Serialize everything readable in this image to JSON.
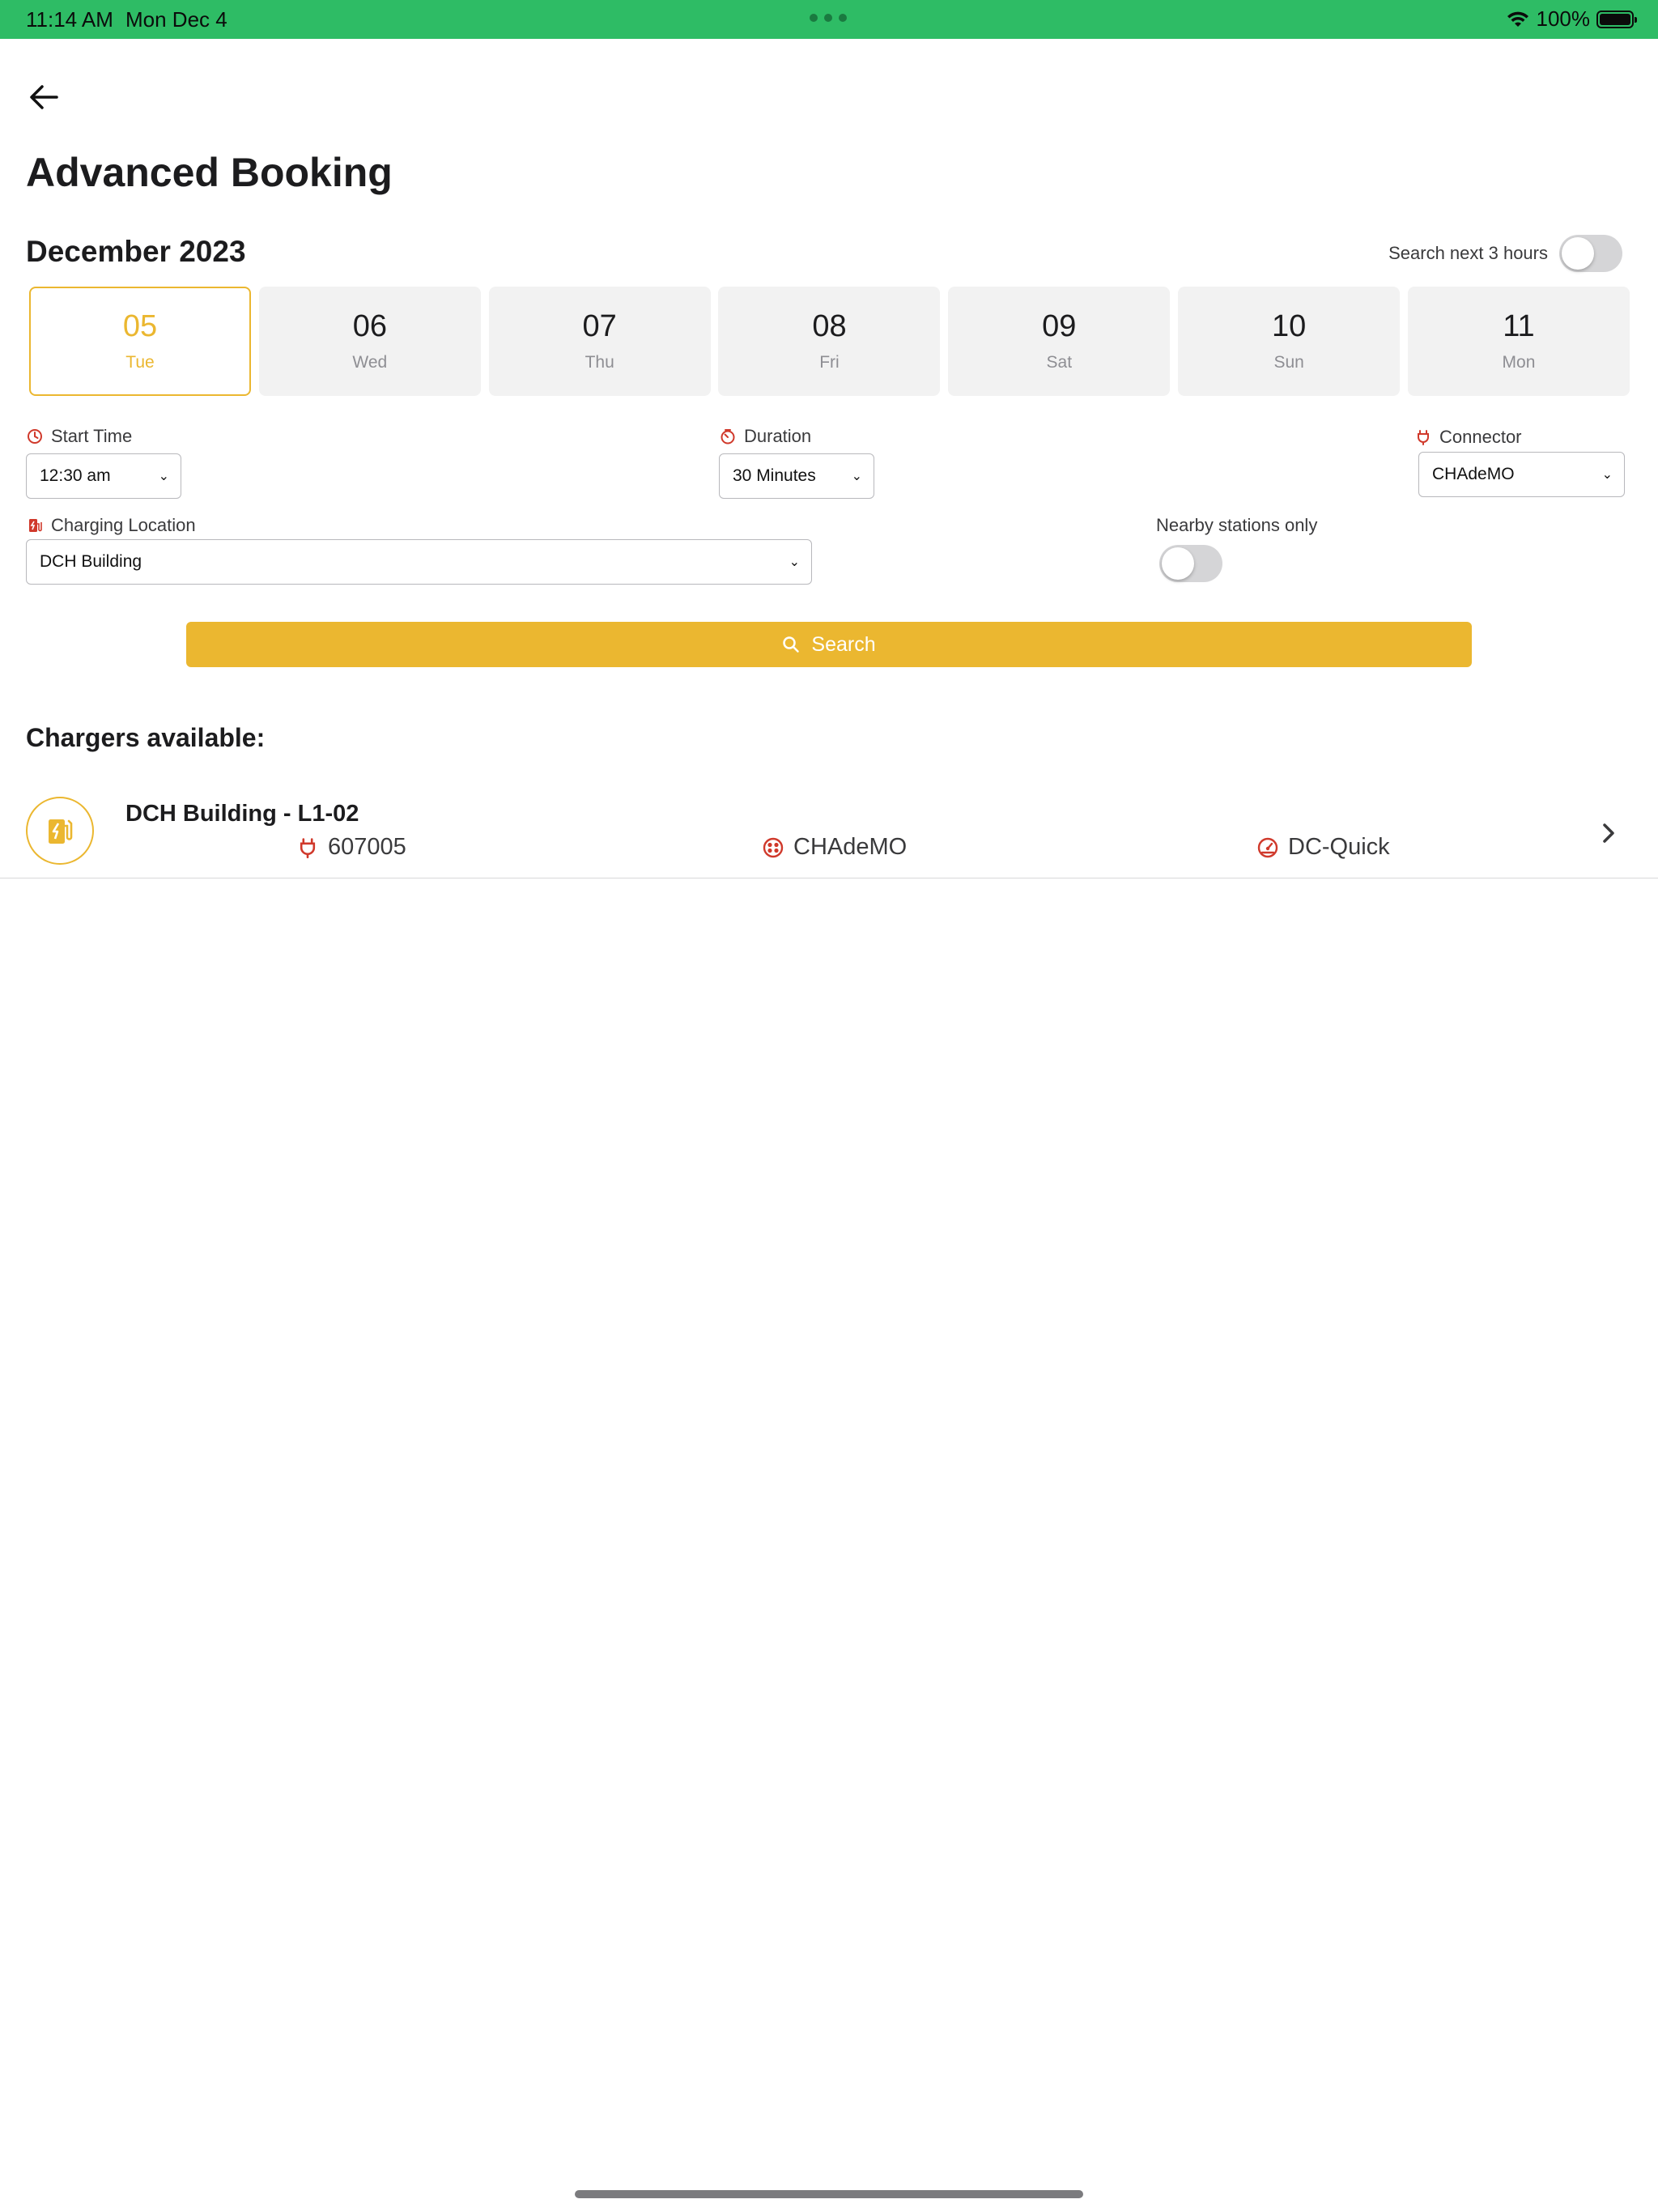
{
  "status_bar": {
    "time": "11:14 AM",
    "date": "Mon Dec 4",
    "battery": "100%",
    "color": "#2ebc65"
  },
  "header": {
    "back_icon": "arrow-left-icon",
    "title": "Advanced Booking"
  },
  "calendar": {
    "month": "December 2023",
    "search_next_label": "Search next 3 hours",
    "search_next_on": false,
    "days": [
      {
        "num": "05",
        "day": "Tue",
        "selected": true
      },
      {
        "num": "06",
        "day": "Wed",
        "selected": false
      },
      {
        "num": "07",
        "day": "Thu",
        "selected": false
      },
      {
        "num": "08",
        "day": "Fri",
        "selected": false
      },
      {
        "num": "09",
        "day": "Sat",
        "selected": false
      },
      {
        "num": "10",
        "day": "Sun",
        "selected": false
      },
      {
        "num": "11",
        "day": "Mon",
        "selected": false
      }
    ]
  },
  "filters": {
    "start_time": {
      "label": "Start Time",
      "value": "12:30 am",
      "icon": "clock-icon"
    },
    "duration": {
      "label": "Duration",
      "value": "30 Minutes",
      "icon": "timer-icon"
    },
    "connector": {
      "label": "Connector",
      "value": "CHAdeMO",
      "icon": "plug-icon"
    },
    "location": {
      "label": "Charging Location",
      "value": "DCH Building",
      "icon": "charging-station-icon"
    },
    "nearby": {
      "label": "Nearby stations only",
      "on": false
    }
  },
  "search": {
    "label": "Search",
    "icon": "search-icon"
  },
  "results": {
    "title": "Chargers available:",
    "items": [
      {
        "name": "DCH Building - L1-02",
        "id": "607005",
        "connector": "CHAdeMO",
        "speed": "DC-Quick",
        "icon": "ev-station-icon"
      }
    ]
  },
  "colors": {
    "accent": "#ebb730",
    "icon_red": "#d0392b",
    "status_bar": "#2ebc65"
  }
}
